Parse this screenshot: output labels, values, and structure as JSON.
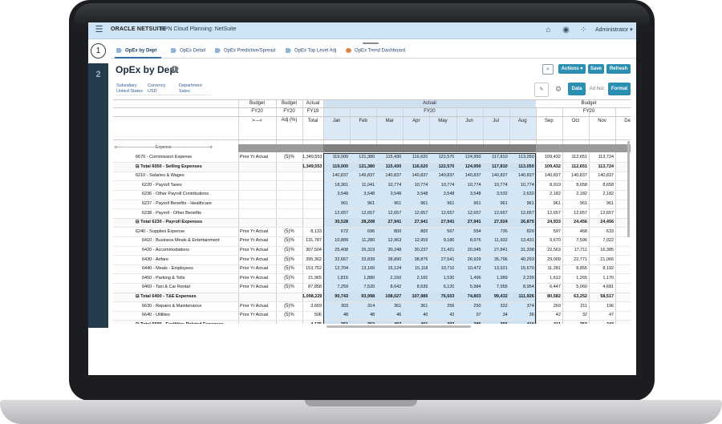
{
  "app": {
    "brand": "ORACLE NETSUITE",
    "title": "EPN Cloud Planning: NetSuite",
    "user": "Administrator ▾",
    "icons": [
      "hamburger-icon",
      "home-icon",
      "accessibility-icon",
      "apps-icon"
    ]
  },
  "nav": {
    "steps": [
      "1",
      "2"
    ]
  },
  "tabs": [
    {
      "label": "OpEx by Dept",
      "icon": "form-icon"
    },
    {
      "label": "OpEx Detail",
      "icon": "form-icon"
    },
    {
      "label": "OpEx Predictive/Spread",
      "icon": "form-icon"
    },
    {
      "label": "OpEx Top Level Adj",
      "icon": "form-icon"
    },
    {
      "label": "OpEx Trend Dashboard",
      "icon": "dashboard-icon"
    }
  ],
  "page": {
    "title": "OpEx by Dept",
    "info_icon": "i"
  },
  "actions": {
    "actions_label": "Actions ▾",
    "save_label": "Save",
    "refresh_label": "Refresh"
  },
  "pov": [
    {
      "dimension": "Subsidiary",
      "value": "United States"
    },
    {
      "dimension": "Currency",
      "value": "USD"
    },
    {
      "dimension": "Department",
      "value": "Sales"
    }
  ],
  "toolbar": {
    "data_label": "Data",
    "adhoc_label": "Ad hoc",
    "format_label": "Format"
  },
  "grid": {
    "col_headers_row1": [
      "Budget",
      "Budget",
      "Actual",
      "Actual",
      "Budget"
    ],
    "col_headers_row2": [
      "FY20",
      "FY20",
      "FY19",
      "FY20",
      "FY20"
    ],
    "col_headers_row3": [
      ">---<",
      "Adj (%)",
      "Total",
      "Jan",
      "Feb",
      "Mar",
      "Apr",
      "May",
      "Jun",
      "Jul",
      "Aug",
      "Sep",
      "Oct",
      "Nov",
      "Dec"
    ],
    "section_label": "o-----------------------------Expense-----------------------------o",
    "rows": [
      {
        "label": "6670 - Commission Expense",
        "indent": 1,
        "bold": false,
        "method": "Prior Yr Actual",
        "adj": "(5)%",
        "total": "1,349,553",
        "m": [
          "119,000",
          "121,380",
          "115,430",
          "116,620",
          "122,570",
          "124,950",
          "117,810",
          "113,050",
          "109,432",
          "112,651",
          "113,724",
          ""
        ]
      },
      {
        "label": "⊟ Total 6050 - Selling Expenses",
        "indent": 1,
        "bold": true,
        "method": "",
        "adj": "",
        "total": "1,349,553",
        "m": [
          "119,000",
          "121,380",
          "115,430",
          "116,620",
          "122,570",
          "124,950",
          "117,810",
          "113,050",
          "109,432",
          "112,651",
          "113,724",
          ""
        ]
      },
      {
        "label": "6210 - Salaries & Wages",
        "indent": 1,
        "bold": false,
        "method": "",
        "adj": "",
        "total": "",
        "m": [
          "140,837",
          "149,837",
          "140,837",
          "140,837",
          "140,837",
          "140,837",
          "140,837",
          "140,837",
          "140,837",
          "140,837",
          "140,837",
          ""
        ]
      },
      {
        "label": "6220 - Payroll Taxes",
        "indent": 2,
        "bold": false,
        "method": "",
        "adj": "",
        "total": "",
        "m": [
          "18,361",
          "11,041",
          "10,774",
          "10,774",
          "10,774",
          "10,774",
          "10,774",
          "10,774",
          "8,919",
          "8,658",
          "8,658",
          ""
        ]
      },
      {
        "label": "6236 - Other Payroll Contributions",
        "indent": 2,
        "bold": false,
        "method": "",
        "adj": "",
        "total": "",
        "m": [
          "3,548",
          "3,548",
          "3,548",
          "3,548",
          "3,548",
          "3,548",
          "3,532",
          "2,632",
          "2,182",
          "2,182",
          "2,182",
          ""
        ]
      },
      {
        "label": "6237 - Payroll Benefits - Healthcare",
        "indent": 2,
        "bold": false,
        "method": "",
        "adj": "",
        "total": "",
        "m": [
          "961",
          "961",
          "961",
          "961",
          "961",
          "961",
          "961",
          "961",
          "961",
          "961",
          "961",
          ""
        ]
      },
      {
        "label": "6238 - Payroll - Other Benefits",
        "indent": 2,
        "bold": false,
        "method": "",
        "adj": "",
        "total": "",
        "m": [
          "12,657",
          "12,657",
          "12,657",
          "12,657",
          "12,657",
          "12,657",
          "12,657",
          "12,657",
          "12,657",
          "12,657",
          "12,657",
          ""
        ]
      },
      {
        "label": "⊟ Total 6230 - Payroll Expenses",
        "indent": 1,
        "bold": true,
        "method": "",
        "adj": "",
        "total": "",
        "m": [
          "35,528",
          "28,208",
          "27,941",
          "27,941",
          "27,941",
          "27,941",
          "27,924",
          "26,875",
          "24,933",
          "24,456",
          "24,456",
          ""
        ]
      },
      {
        "label": "6240 - Supplies Expense",
        "indent": 1,
        "bold": false,
        "method": "Prior Yr Actual",
        "adj": "(5)%",
        "total": "8,133",
        "m": [
          "672",
          "696",
          "800",
          "800",
          "567",
          "554",
          "736",
          "829",
          "597",
          "468",
          "633",
          ""
        ]
      },
      {
        "label": "6410 - Business Meals & Entertainment",
        "indent": 2,
        "bold": false,
        "method": "Prior Yr Actual",
        "adj": "(5)%",
        "total": "131,787",
        "m": [
          "10,889",
          "11,280",
          "12,963",
          "12,959",
          "9,180",
          "8,976",
          "11,932",
          "13,431",
          "9,670",
          "7,596",
          "7,022",
          ""
        ]
      },
      {
        "label": "6420 - Accommodations",
        "indent": 2,
        "bold": false,
        "method": "Prior Yr Actual",
        "adj": "(5)%",
        "total": "307,504",
        "m": [
          "25,408",
          "26,319",
          "30,248",
          "30,237",
          "21,421",
          "20,945",
          "27,841",
          "31,338",
          "22,563",
          "17,711",
          "16,385",
          ""
        ]
      },
      {
        "label": "6430 - Airfare",
        "indent": 2,
        "bold": false,
        "method": "Prior Yr Actual",
        "adj": "(5)%",
        "total": "395,362",
        "m": [
          "32,667",
          "33,839",
          "38,890",
          "38,876",
          "27,541",
          "26,929",
          "35,796",
          "40,293",
          "29,009",
          "22,771",
          "21,066",
          ""
        ]
      },
      {
        "label": "6440 - Meals - Employees",
        "indent": 2,
        "bold": false,
        "method": "Prior Yr Actual",
        "adj": "(5)%",
        "total": "153,752",
        "m": [
          "12,704",
          "13,160",
          "15,124",
          "15,118",
          "10,710",
          "10,472",
          "13,921",
          "15,670",
          "11,281",
          "8,855",
          "8,192",
          ""
        ]
      },
      {
        "label": "6450 - Parking & Tolls",
        "indent": 2,
        "bold": false,
        "method": "Prior Yr Actual",
        "adj": "(5)%",
        "total": "21,965",
        "m": [
          "1,815",
          "1,880",
          "2,160",
          "2,160",
          "1,530",
          "1,496",
          "1,989",
          "2,239",
          "1,612",
          "1,265",
          "1,170",
          ""
        ]
      },
      {
        "label": "6460 - Taxi & Car Rental",
        "indent": 2,
        "bold": false,
        "method": "Prior Yr Actual",
        "adj": "(5)%",
        "total": "87,858",
        "m": [
          "7,259",
          "7,520",
          "8,642",
          "8,639",
          "6,120",
          "5,984",
          "7,955",
          "8,954",
          "6,447",
          "5,060",
          "4,681",
          ""
        ]
      },
      {
        "label": "⊟ Total 6400 - T&E Expenses",
        "indent": 1,
        "bold": true,
        "method": "",
        "adj": "",
        "total": "1,098,229",
        "m": [
          "90,743",
          "93,998",
          "108,027",
          "107,989",
          "76,503",
          "74,803",
          "99,432",
          "111,926",
          "80,582",
          "63,252",
          "58,517",
          ""
        ]
      },
      {
        "label": "6630 - Repairs & Maintenance",
        "indent": 2,
        "bold": false,
        "method": "Prior Yr Actual",
        "adj": "(5)%",
        "total": "3,669",
        "m": [
          "303",
          "314",
          "361",
          "361",
          "256",
          "250",
          "332",
          "374",
          "269",
          "211",
          "196",
          ""
        ]
      },
      {
        "label": "6640 - Utilities",
        "indent": 2,
        "bold": false,
        "method": "Prior Yr Actual",
        "adj": "(5)%",
        "total": "506",
        "m": [
          "48",
          "48",
          "46",
          "40",
          "42",
          "37",
          "34",
          "36",
          "42",
          "32",
          "47",
          ""
        ]
      },
      {
        "label": "⊟ Total 6690 - Facilities Related Expenses",
        "indent": 1,
        "bold": true,
        "method": "",
        "adj": "",
        "total": "4,175",
        "m": [
          "351",
          "362",
          "407",
          "401",
          "297",
          "286",
          "366",
          "410",
          "311",
          "253",
          "243",
          ""
        ]
      }
    ]
  }
}
